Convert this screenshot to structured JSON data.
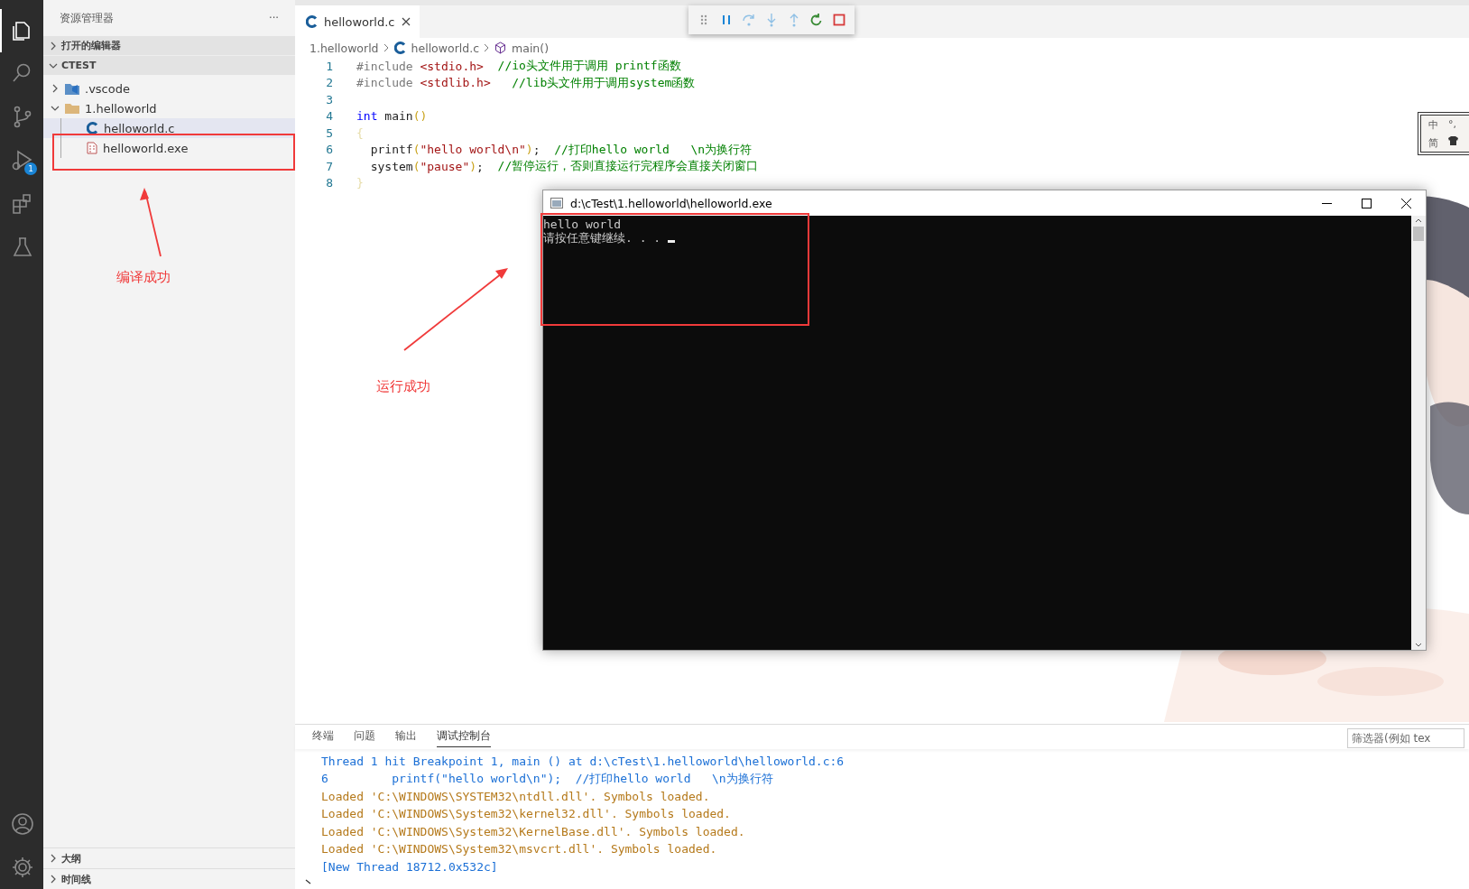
{
  "activity_bar": {
    "items": [
      {
        "kind": "explorer",
        "selected": true
      },
      {
        "kind": "search",
        "selected": false
      },
      {
        "kind": "source-control",
        "selected": false
      },
      {
        "kind": "debug",
        "selected": false,
        "badge": "1"
      },
      {
        "kind": "extensions",
        "selected": false
      },
      {
        "kind": "testing",
        "selected": false
      }
    ],
    "bottom_items": [
      {
        "kind": "account"
      },
      {
        "kind": "settings"
      }
    ]
  },
  "sidebar": {
    "title": "资源管理器",
    "more": "···",
    "sections": [
      {
        "label": "打开的编辑器",
        "expanded": false
      },
      {
        "label": "CTEST",
        "expanded": true
      }
    ],
    "tree": [
      {
        "label": ".vscode",
        "kind": "vscode-folder",
        "expanded": false,
        "selected": false
      },
      {
        "label": "1.helloworld",
        "kind": "folder",
        "expanded": true,
        "selected": false,
        "children": [
          {
            "label": "helloworld.c",
            "kind": "c-file",
            "selected": true
          },
          {
            "label": "helloworld.exe",
            "kind": "exe-file",
            "selected": false
          }
        ]
      }
    ],
    "bottom_sections": [
      {
        "label": "大纲",
        "expanded": false
      },
      {
        "label": "时间线",
        "expanded": false
      }
    ]
  },
  "tabs": [
    {
      "label": "helloworld.c",
      "selected": true
    }
  ],
  "debug_toolbar": [
    {
      "kind": "grip",
      "disabled": false
    },
    {
      "kind": "pause",
      "disabled": false
    },
    {
      "kind": "step-over",
      "disabled": true
    },
    {
      "kind": "step-into",
      "disabled": true
    },
    {
      "kind": "step-out",
      "disabled": true
    },
    {
      "kind": "restart",
      "disabled": false
    },
    {
      "kind": "stop",
      "disabled": false
    }
  ],
  "breadcrumb": [
    {
      "label": "1.helloworld",
      "kind": "folder"
    },
    {
      "label": "helloworld.c",
      "kind": "c-file"
    },
    {
      "label": "main()",
      "kind": "function"
    }
  ],
  "code": [
    {
      "number": "1",
      "tokens": [
        {
          "text": "#include ",
          "kind": "directive"
        },
        {
          "text": "<stdio.h>",
          "kind": "string"
        },
        {
          "text": "  //io头文件用于调用 printf函数",
          "kind": "comment"
        }
      ]
    },
    {
      "number": "2",
      "tokens": [
        {
          "text": "#include ",
          "kind": "directive"
        },
        {
          "text": "<stdlib.h>",
          "kind": "string"
        },
        {
          "text": "   //lib头文件用于调用system函数",
          "kind": "comment"
        }
      ]
    },
    {
      "number": "3"
    },
    {
      "number": "4",
      "tokens": [
        {
          "text": "int",
          "kind": "keyword"
        },
        {
          "text": " main",
          "kind": "plain"
        },
        {
          "text": "()",
          "kind": "bracket"
        }
      ]
    },
    {
      "number": "5",
      "tokens": [
        {
          "text": "{",
          "kind": "faded-bracket"
        }
      ]
    },
    {
      "number": "6",
      "tokens": [
        {
          "text": "  printf",
          "kind": "plain"
        },
        {
          "text": "(",
          "kind": "bracket"
        },
        {
          "text": "\"hello world\\n\"",
          "kind": "string"
        },
        {
          "text": ")",
          "kind": "bracket"
        },
        {
          "text": ";",
          "kind": "plain"
        },
        {
          "text": "  //打印hello world   \\n为换行符",
          "kind": "comment"
        }
      ]
    },
    {
      "number": "7",
      "tokens": [
        {
          "text": "  system",
          "kind": "plain"
        },
        {
          "text": "(",
          "kind": "bracket"
        },
        {
          "text": "\"pause\"",
          "kind": "string"
        },
        {
          "text": ")",
          "kind": "bracket"
        },
        {
          "text": ";",
          "kind": "plain"
        },
        {
          "text": "  //暂停运行，否则直接运行完程序会直接关闭窗口",
          "kind": "comment"
        }
      ]
    },
    {
      "number": "8",
      "tokens": [
        {
          "text": "}",
          "kind": "faded-bracket"
        }
      ]
    }
  ],
  "console_window": {
    "title": "d:\\cTest\\1.helloworld\\helloworld.exe",
    "lines": [
      "hello world",
      "请按任意键继续. . . "
    ]
  },
  "ime": {
    "rows": [
      [
        "中",
        "°,"
      ],
      [
        "简"
      ]
    ]
  },
  "panel": {
    "tabs": [
      {
        "label": "终端",
        "selected": false
      },
      {
        "label": "问题",
        "selected": false
      },
      {
        "label": "输出",
        "selected": false
      },
      {
        "label": "调试控制台",
        "selected": true
      }
    ],
    "filter": {
      "placeholder": "筛选器(例如 tex"
    },
    "lines": [
      {
        "text": "Thread 1 hit Breakpoint 1, main () at d:\\cTest\\1.helloworld\\helloworld.c:6",
        "kind": "info"
      },
      {
        "text": "6         printf(\"hello world\\n\");  //打印hello world   \\n为换行符",
        "kind": "info"
      },
      {
        "text": "Loaded 'C:\\WINDOWS\\SYSTEM32\\ntdll.dll'. Symbols loaded.",
        "kind": "log"
      },
      {
        "text": "Loaded 'C:\\WINDOWS\\System32\\kernel32.dll'. Symbols loaded.",
        "kind": "log"
      },
      {
        "text": "Loaded 'C:\\WINDOWS\\System32\\KernelBase.dll'. Symbols loaded.",
        "kind": "log"
      },
      {
        "text": "Loaded 'C:\\WINDOWS\\System32\\msvcrt.dll'. Symbols loaded.",
        "kind": "log"
      },
      {
        "text": "[New Thread 18712.0x532c]",
        "kind": "info"
      }
    ]
  },
  "annotations": [
    {
      "text": "编译成功"
    },
    {
      "text": "运行成功"
    }
  ]
}
